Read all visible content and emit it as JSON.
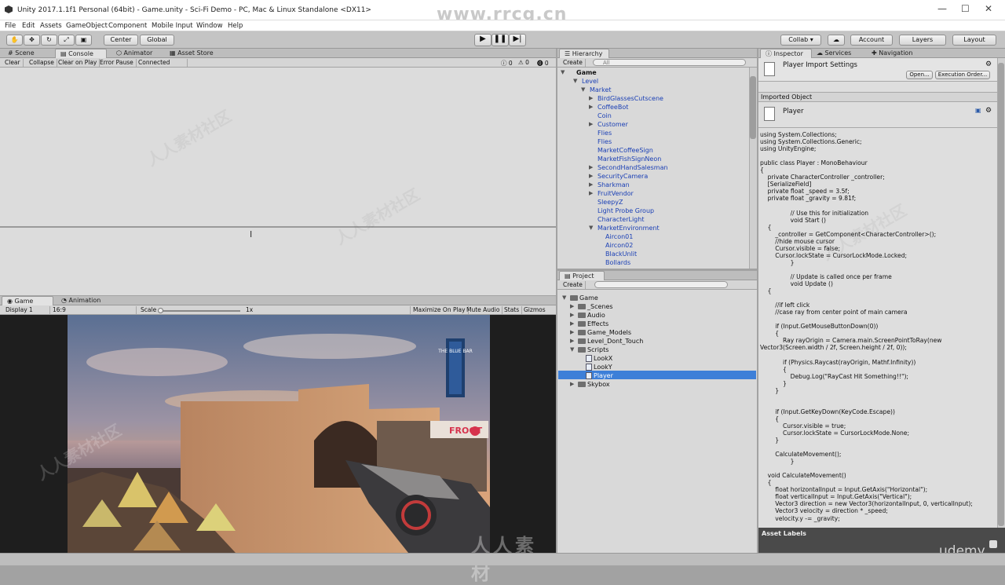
{
  "window": {
    "title": "Unity 2017.1.1f1 Personal (64bit) - Game.unity - Sci-Fi Demo - PC, Mac & Linux Standalone <DX11>",
    "watermark_url": "www.rrcg.cn"
  },
  "menu": [
    "File",
    "Edit",
    "Assets",
    "GameObject",
    "Component",
    "Mobile Input",
    "Window",
    "Help"
  ],
  "toolbar": {
    "center": "Center",
    "global": "Global",
    "collab": "Collab ▾",
    "account": "Account",
    "layers": "Layers",
    "layout": "Layout"
  },
  "left_tabs": {
    "scene": "Scene",
    "console": "Console",
    "animator": "Animator",
    "asset_store": "Asset Store"
  },
  "console": {
    "clear": "Clear",
    "collapse": "Collapse",
    "clear_on_play": "Clear on Play",
    "error_pause": "Error Pause",
    "connected_player": "Connected Player",
    "count_log": "0",
    "count_warn": "0",
    "count_err": "0"
  },
  "game_tabs": {
    "game": "Game",
    "animation": "Animation"
  },
  "game_bar": {
    "display": "Display 1",
    "aspect": "16:9",
    "scale_label": "Scale",
    "scale_value": "1x",
    "maximize": "Maximize On Play",
    "mute": "Mute Audio",
    "stats": "Stats",
    "gizmos": "Gizmos"
  },
  "scene_sign": {
    "bar_name": "THE BLUE BAR",
    "froot": "FROOT"
  },
  "hierarchy": {
    "tab": "Hierarchy",
    "create": "Create",
    "search_placeholder": "All",
    "scene": "Game",
    "items": [
      {
        "label": "Level",
        "indent": 0,
        "arrow": "▼"
      },
      {
        "label": "Market",
        "indent": 1,
        "arrow": "▼"
      },
      {
        "label": "BirdGlassesCutscene",
        "indent": 2,
        "arrow": "▶"
      },
      {
        "label": "CoffeeBot",
        "indent": 2,
        "arrow": "▶"
      },
      {
        "label": "Coin",
        "indent": 2,
        "arrow": ""
      },
      {
        "label": "Customer",
        "indent": 2,
        "arrow": "▶"
      },
      {
        "label": "Flies",
        "indent": 2,
        "arrow": ""
      },
      {
        "label": "Flies",
        "indent": 2,
        "arrow": ""
      },
      {
        "label": "MarketCoffeeSign",
        "indent": 2,
        "arrow": ""
      },
      {
        "label": "MarketFishSignNeon",
        "indent": 2,
        "arrow": ""
      },
      {
        "label": "SecondHandSalesman",
        "indent": 2,
        "arrow": "▶"
      },
      {
        "label": "SecurityCamera",
        "indent": 2,
        "arrow": "▶"
      },
      {
        "label": "Sharkman",
        "indent": 2,
        "arrow": "▶"
      },
      {
        "label": "FruitVendor",
        "indent": 2,
        "arrow": "▶"
      },
      {
        "label": "SleepyZ",
        "indent": 2,
        "arrow": ""
      },
      {
        "label": "Light Probe Group",
        "indent": 2,
        "arrow": ""
      },
      {
        "label": "CharacterLight",
        "indent": 2,
        "arrow": ""
      },
      {
        "label": "MarketEnvironment",
        "indent": 2,
        "arrow": "▼"
      },
      {
        "label": "Aircon01",
        "indent": 3,
        "arrow": ""
      },
      {
        "label": "Aircon02",
        "indent": 3,
        "arrow": ""
      },
      {
        "label": "BlackUnlit",
        "indent": 3,
        "arrow": ""
      },
      {
        "label": "Bollards",
        "indent": 3,
        "arrow": ""
      }
    ]
  },
  "project": {
    "tab": "Project",
    "create": "Create",
    "items": [
      {
        "label": "Game",
        "indent": 0,
        "arrow": "▼",
        "kind": "folder"
      },
      {
        "label": "_Scenes",
        "indent": 1,
        "arrow": "▶",
        "kind": "folder"
      },
      {
        "label": "Audio",
        "indent": 1,
        "arrow": "▶",
        "kind": "folder"
      },
      {
        "label": "Effects",
        "indent": 1,
        "arrow": "▶",
        "kind": "folder"
      },
      {
        "label": "Game_Models",
        "indent": 1,
        "arrow": "▶",
        "kind": "folder"
      },
      {
        "label": "Level_Dont_Touch",
        "indent": 1,
        "arrow": "▶",
        "kind": "folder"
      },
      {
        "label": "Scripts",
        "indent": 1,
        "arrow": "▼",
        "kind": "folder"
      },
      {
        "label": "LookX",
        "indent": 2,
        "arrow": "",
        "kind": "script"
      },
      {
        "label": "LookY",
        "indent": 2,
        "arrow": "",
        "kind": "script"
      },
      {
        "label": "Player",
        "indent": 2,
        "arrow": "",
        "kind": "script",
        "selected": true
      },
      {
        "label": "Skybox",
        "indent": 1,
        "arrow": "▶",
        "kind": "folder"
      }
    ]
  },
  "right_tabs": {
    "inspector": "Inspector",
    "services": "Services",
    "navigation": "Navigation"
  },
  "inspector": {
    "header": "Player Import Settings",
    "open": "Open...",
    "execution_order": "Execution Order...",
    "imported_object": "Imported Object",
    "object_name": "Player",
    "asset_labels": "Asset Labels",
    "code": "using System.Collections;\nusing System.Collections.Generic;\nusing UnityEngine;\n\npublic class Player : MonoBehaviour\n{\n    private CharacterController _controller;\n    [SerializeField]\n    private float _speed = 3.5f;\n    private float _gravity = 9.81f;\n\n                // Use this for initialization\n                void Start ()\n    {\n        _controller = GetComponent<CharacterController>();\n        //hide mouse cursor\n        Cursor.visible = false;\n        Cursor.lockState = CursorLockMode.Locked;\n                }\n\n                // Update is called once per frame\n                void Update ()\n    {\n\n        //if left click\n        //case ray from center point of main camera\n\n        if (Input.GetMouseButtonDown(0))\n        {\n            Ray rayOrigin = Camera.main.ScreenPointToRay(new\nVector3(Screen.width / 2f, Screen.height / 2f, 0));\n\n            if (Physics.Raycast(rayOrigin, Mathf.Infinity))\n            {\n                Debug.Log(\"RayCast Hit Something!!\");\n            }\n        }\n\n\n        if (Input.GetKeyDown(KeyCode.Escape))\n        {\n            Cursor.visible = true;\n            Cursor.lockState = CursorLockMode.None;\n        }\n\n        CalculateMovement();\n                }\n\n    void CalculateMovement()\n    {\n        float horizontalInput = Input.GetAxis(\"Horizontal\");\n        float verticalInput = Input.GetAxis(\"Vertical\");\n        Vector3 direction = new Vector3(horizontalInput, 0, verticalInput);\n        Vector3 velocity = direction * _speed;\n        velocity.y -= _gravity;"
  },
  "watermarks": {
    "bottom_logo": "人人素材",
    "udemy": "udemy",
    "tile": "人人素材社区"
  }
}
